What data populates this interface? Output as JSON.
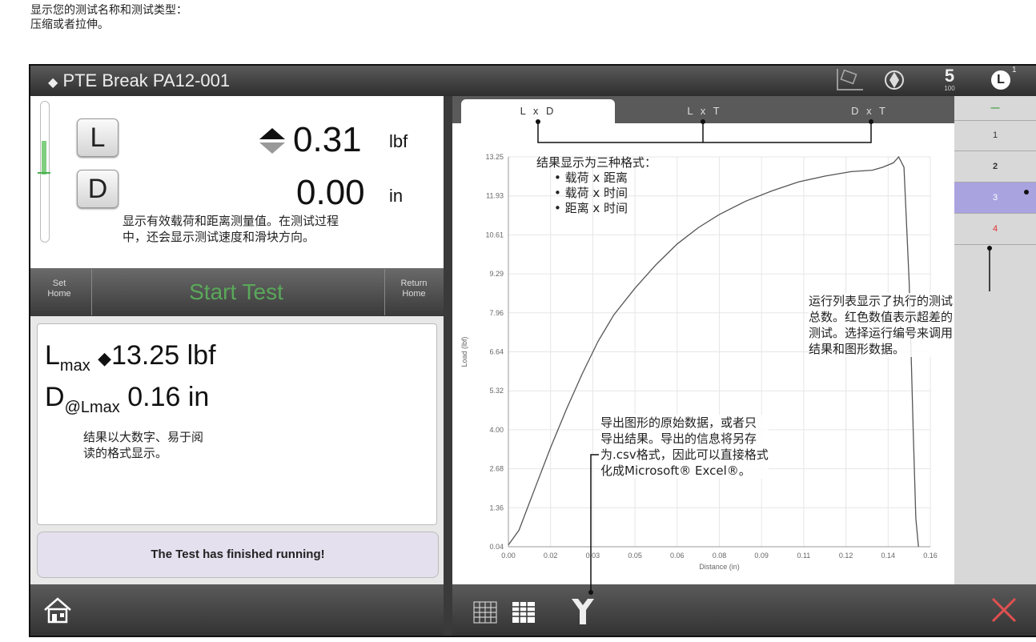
{
  "top_note": [
    "显示您的测试名称和测试类型：",
    "压缩或者拉伸。"
  ],
  "titlebar": {
    "title": "PTE Break PA12-001",
    "speed_value": "5",
    "speed_sub": "100",
    "badge": "1"
  },
  "readouts": {
    "load_key": "L",
    "load_value": "0.31",
    "load_unit": "lbf",
    "dist_key": "D",
    "dist_value": "0.00",
    "dist_unit": "in"
  },
  "actions": {
    "set_home": [
      "Set",
      "Home"
    ],
    "start_test": "Start Test",
    "return_home": [
      "Return",
      "Home"
    ]
  },
  "results": {
    "lmax_label": "L",
    "lmax_sub": "max",
    "lmax_value": "13.25 lbf",
    "dlmax_label": "D",
    "dlmax_sub": "@Lmax",
    "dlmax_value": "0.16 in"
  },
  "status": "The Test has finished running!",
  "tabs": [
    "L x D",
    "L x T",
    "D x T"
  ],
  "runs": {
    "header": "—",
    "items": [
      "1",
      "2",
      "3",
      "4"
    ],
    "selected": "3",
    "failed": "4"
  },
  "annotations": {
    "readouts": [
      "显示有效载荷和距离测量值。在测试过程",
      "中，还会显示测试速度和滑块方向。"
    ],
    "results": [
      "结果以大数字、易于阅",
      "读的格式显示。"
    ],
    "tabs_title": "结果显示为三种格式：",
    "tabs_list": [
      "载荷 x 距离",
      "载荷 x 时间",
      "距离 x 时间"
    ],
    "runs": [
      "运行列表显示了执行的测试",
      "总数。红色数值表示超差的",
      "测试。选择运行编号来调用",
      "结果和图形数据。"
    ],
    "export": [
      "导出图形的原始数据，或者只",
      "导出结果。导出的信息将另存",
      "为.csv格式，因此可以直接格式",
      "化成Microsoft® Excel®。"
    ]
  },
  "colors": {
    "start_test": "#5aa85a",
    "failed_run": "#e03030",
    "selected_run": "#a9a3e0",
    "close": "#e05050"
  },
  "chart_data": {
    "type": "line",
    "xlabel": "Distance (in)",
    "ylabel": "Load (lbf)",
    "x_ticks": [
      "0.00",
      "0.02",
      "0.03",
      "0.05",
      "0.06",
      "0.08",
      "0.09",
      "0.11",
      "0.12",
      "0.14",
      "0.16"
    ],
    "y_ticks": [
      "13.25",
      "11.93",
      "10.61",
      "9.29",
      "7.96",
      "6.64",
      "5.32",
      "4.00",
      "2.68",
      "1.36",
      "0.04"
    ],
    "xlim": [
      0.0,
      0.16
    ],
    "ylim": [
      0.04,
      13.25
    ],
    "grid": true,
    "series": [
      {
        "x": [
          0.0,
          0.004,
          0.01,
          0.016,
          0.022,
          0.028,
          0.034,
          0.04,
          0.048,
          0.056,
          0.064,
          0.072,
          0.08,
          0.09,
          0.1,
          0.11,
          0.12,
          0.13,
          0.138,
          0.142,
          0.146,
          0.148,
          0.15,
          0.152,
          0.1535,
          0.1545,
          0.1555
        ],
        "y": [
          0.1,
          0.6,
          2.0,
          3.4,
          4.7,
          5.9,
          7.0,
          7.9,
          8.8,
          9.6,
          10.3,
          10.85,
          11.3,
          11.75,
          12.1,
          12.4,
          12.6,
          12.75,
          12.8,
          12.9,
          13.05,
          13.25,
          12.9,
          9.0,
          4.0,
          1.0,
          0.04
        ]
      }
    ]
  }
}
